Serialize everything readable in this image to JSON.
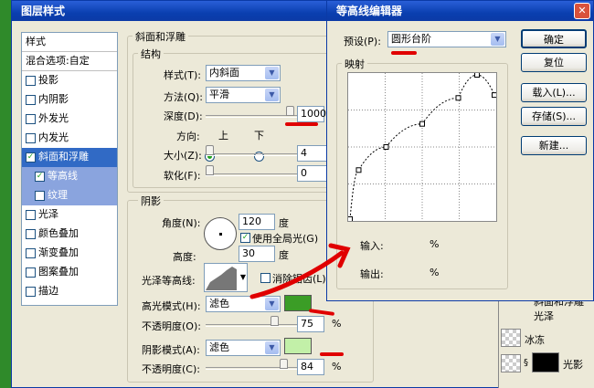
{
  "layer_style": {
    "title": "图层样式",
    "style_list": [
      {
        "label": "样式",
        "type": "header"
      },
      {
        "label": "混合选项:自定",
        "type": "header"
      },
      {
        "label": "投影",
        "checked": false
      },
      {
        "label": "内阴影",
        "checked": false
      },
      {
        "label": "外发光",
        "checked": false
      },
      {
        "label": "内发光",
        "checked": false
      },
      {
        "label": "斜面和浮雕",
        "checked": true,
        "active": true
      },
      {
        "label": "等高线",
        "checked": true,
        "sub": true
      },
      {
        "label": "纹理",
        "checked": false,
        "sub": true
      },
      {
        "label": "光泽",
        "checked": false
      },
      {
        "label": "颜色叠加",
        "checked": false
      },
      {
        "label": "渐变叠加",
        "checked": false
      },
      {
        "label": "图案叠加",
        "checked": false
      },
      {
        "label": "描边",
        "checked": false
      }
    ],
    "bevel_group": "斜面和浮雕",
    "structure_group": "结构",
    "style_label": "样式(T):",
    "style_value": "内斜面",
    "method_label": "方法(Q):",
    "method_value": "平滑",
    "depth_label": "深度(D):",
    "depth_value": "1000",
    "direction_label": "方向:",
    "dir_up": "上",
    "dir_down": "下",
    "size_label": "大小(Z):",
    "size_value": "4",
    "soften_label": "软化(F):",
    "soften_value": "0",
    "shading_group": "阴影",
    "angle_label": "角度(N):",
    "angle_value": "120",
    "degree": "度",
    "global_light": "使用全局光(G)",
    "altitude_label": "高度:",
    "altitude_value": "30",
    "gloss_label": "光泽等高线:",
    "anti_alias": "消除锯齿(L)",
    "highlight_label": "高光模式(H):",
    "highlight_mode": "滤色",
    "highlight_color": "#3b9d26",
    "opacity1_label": "不透明度(O):",
    "opacity1_value": "75",
    "shadow_label": "阴影模式(A):",
    "shadow_mode": "滤色",
    "shadow_color": "#c2f0a8",
    "opacity2_label": "不透明度(C):",
    "opacity2_value": "84",
    "percent": "%"
  },
  "contour_editor": {
    "title": "等高线编辑器",
    "preset_label": "预设(P):",
    "preset_value": "圆形台阶",
    "mapping_group": "映射",
    "input_label": "输入:",
    "output_label": "输出:",
    "percent": "%",
    "ok": "确定",
    "reset": "复位",
    "load": "载入(L)...",
    "save": "存储(S)...",
    "new": "新建...",
    "curve_points": [
      [
        0,
        0
      ],
      [
        6,
        34
      ],
      [
        25,
        50
      ],
      [
        50,
        66
      ],
      [
        75,
        84
      ],
      [
        88,
        100
      ],
      [
        100,
        86
      ]
    ]
  },
  "layers_panel": {
    "items": [
      "斜面和浮雕",
      "光泽",
      "冰冻",
      "光影"
    ]
  },
  "colors": {
    "accent_blue": "#316ac5",
    "title_blue": "#0a3fb0",
    "window_bg": "#ece9d8",
    "annotation_red": "#e00000"
  }
}
